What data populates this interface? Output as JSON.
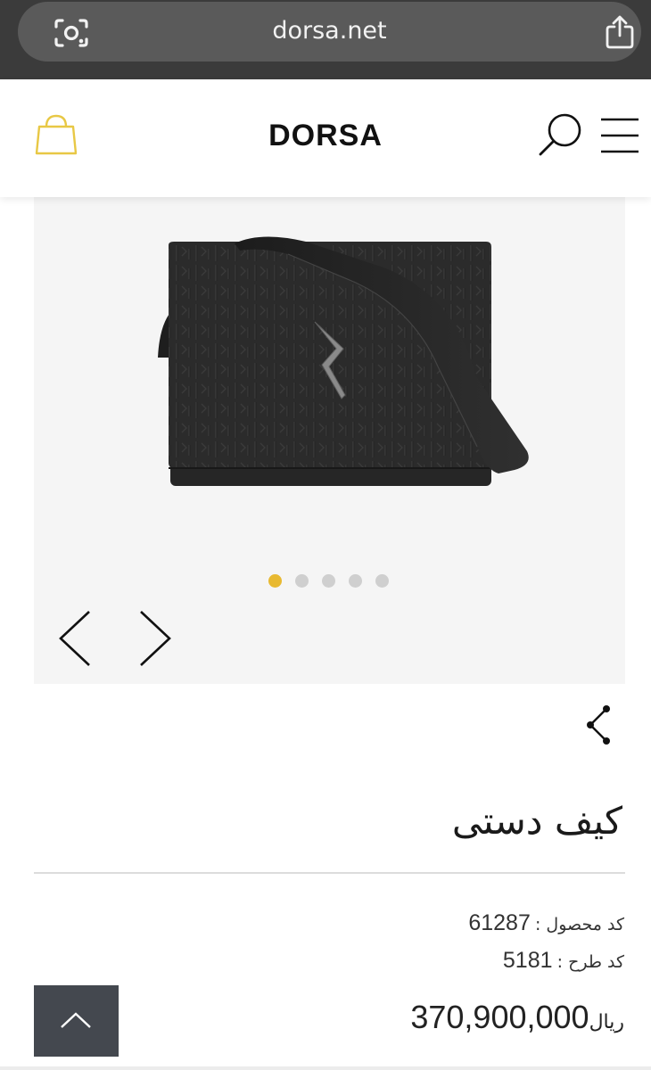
{
  "browser": {
    "url": "dorsa.net",
    "icons": [
      "lens-icon",
      "share-icon"
    ]
  },
  "header": {
    "brand": "DORSA",
    "icons": [
      "shopping-bag-icon",
      "search-icon",
      "hamburger-menu-icon"
    ],
    "accent_color": "#e8c845"
  },
  "gallery": {
    "slide_count": 5,
    "active_slide": 1,
    "active_dot_color": "#e8b931",
    "image_alt": "black embossed leather shoulder bag"
  },
  "product": {
    "title": "کیف دستی",
    "product_code_label": "کد محصول :",
    "product_code": "61287",
    "design_code_label": "کد طرح :",
    "design_code": "5181",
    "price": "370,900,000",
    "currency": "ریال"
  }
}
